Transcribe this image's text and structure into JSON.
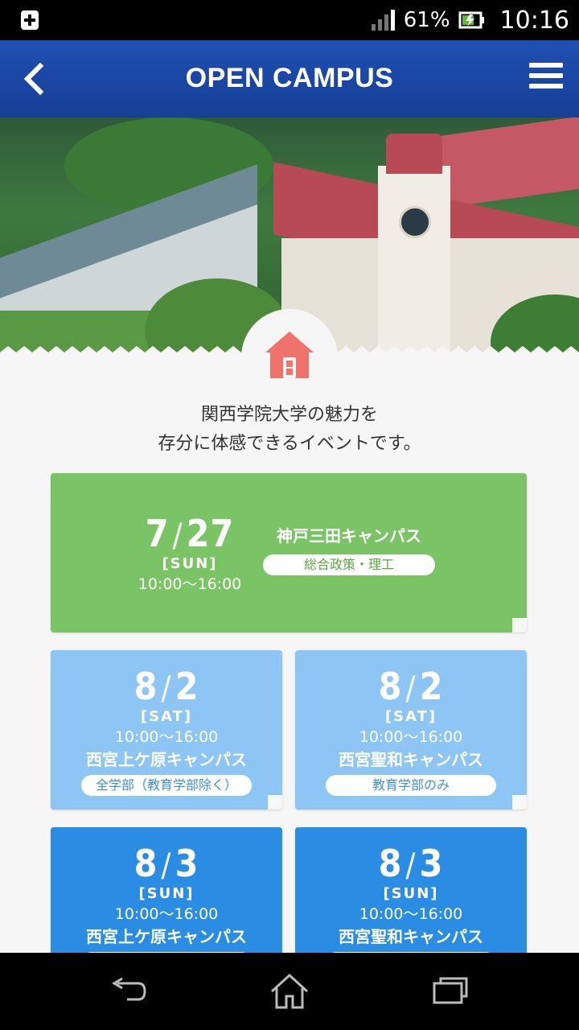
{
  "status_bar": {
    "battery_percent": "61%",
    "time": "10:16",
    "icons": [
      "notification-plus-icon",
      "signal-icon",
      "battery-charging-icon"
    ]
  },
  "header": {
    "title": "OPEN CAMPUS",
    "back_icon": "chevron-left-icon",
    "menu_icon": "hamburger-menu-icon",
    "color": "#1e4fb3"
  },
  "intro": {
    "line1": "関西学院大学の魅力を",
    "line2": "存分に体感できるイベントです。"
  },
  "events": [
    {
      "month": "7",
      "day": "27",
      "dow": "[SUN]",
      "time": "10:00〜16:00",
      "campus": "神戸三田キャンパス",
      "faculties": "総合政策・理工",
      "color": "#7bc466"
    },
    {
      "month": "8",
      "day": "2",
      "dow": "[SAT]",
      "time": "10:00〜16:00",
      "campus": "西宮上ケ原キャンパス",
      "faculties": "全学部（教育学部除く）",
      "color": "#8dc6f5"
    },
    {
      "month": "8",
      "day": "2",
      "dow": "[SAT]",
      "time": "10:00〜16:00",
      "campus": "西宮聖和キャンパス",
      "faculties": "教育学部のみ",
      "color": "#8dc6f5"
    },
    {
      "month": "8",
      "day": "3",
      "dow": "[SUN]",
      "time": "10:00〜16:00",
      "campus": "西宮上ケ原キャンパス",
      "faculties": "",
      "color": "#2b8ce3"
    },
    {
      "month": "8",
      "day": "3",
      "dow": "[SUN]",
      "time": "10:00〜16:00",
      "campus": "西宮聖和キャンパス",
      "faculties": "",
      "color": "#2b8ce3"
    }
  ],
  "accent_house_color": "#f0736b",
  "nav_bar": {
    "icons": [
      "back-arrow-icon",
      "home-icon",
      "recent-apps-icon"
    ]
  }
}
